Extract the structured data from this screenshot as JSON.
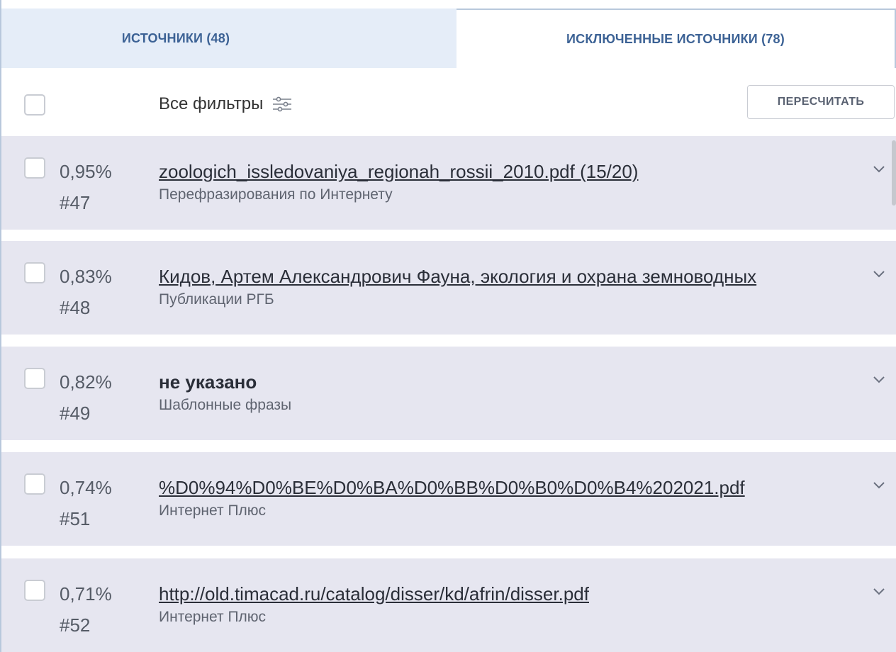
{
  "tabs": {
    "sources": "ИСТОЧНИКИ (48)",
    "excluded": "ИСКЛЮЧЕННЫЕ ИСТОЧНИКИ (78)"
  },
  "toolbar": {
    "filters_label": "Все фильтры",
    "recalculate_label": "ПЕРЕСЧИТАТЬ"
  },
  "rows": [
    {
      "percent": "0,95%",
      "number": "#47",
      "title": "zoologich_issledovaniya_regionah_rossii_2010.pdf (15/20)",
      "subtitle": "Перефразирования по Интернету",
      "is_link": true
    },
    {
      "percent": "0,83%",
      "number": "#48",
      "title": "Кидов, Артем Александрович Фауна, экология и охрана земноводных",
      "subtitle": "Публикации РГБ",
      "is_link": true
    },
    {
      "percent": "0,82%",
      "number": "#49",
      "title": "не указано",
      "subtitle": "Шаблонные фразы",
      "is_link": false
    },
    {
      "percent": "0,74%",
      "number": "#51",
      "title": "%D0%94%D0%BE%D0%BA%D0%BB%D0%B0%D0%B4%202021.pdf",
      "subtitle": "Интернет Плюс",
      "is_link": true
    },
    {
      "percent": "0,71%",
      "number": "#52",
      "title": "http://old.timacad.ru/catalog/disser/kd/afrin/disser.pdf",
      "subtitle": "Интернет Плюс",
      "is_link": true
    }
  ],
  "colors": {
    "accent": "#3c6295",
    "row_background": "#e6e6f0",
    "tab_inactive_background": "#e5edf8"
  },
  "icons": [
    "filter-sliders-icon",
    "chevron-down-icon"
  ]
}
